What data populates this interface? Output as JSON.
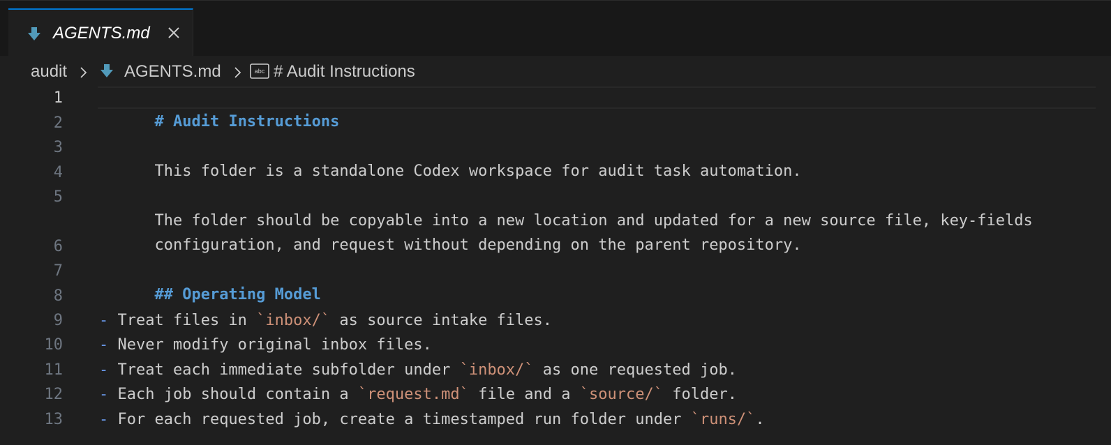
{
  "colors": {
    "accent": "#0078d4",
    "heading": "#569cd6",
    "inline_code": "#ce9178",
    "bullet": "#6796e6",
    "text": "#cccccc",
    "line_number": "#6e7681"
  },
  "tab": {
    "label": "AGENTS.md",
    "icon": "markdown-download-arrow-icon",
    "close_icon": "close-icon"
  },
  "breadcrumb": {
    "folder": "audit",
    "file": "AGENTS.md",
    "symbol": "# Audit Instructions",
    "symbol_icon": "abc-text-icon"
  },
  "editor": {
    "active_line": "1",
    "line_numbers": [
      "1",
      "2",
      "3",
      "4",
      "5",
      "",
      "6",
      "7",
      "8",
      "9",
      "10",
      "11",
      "12",
      "13"
    ],
    "lines": {
      "l1": "# Audit Instructions",
      "l3": "This folder is a standalone Codex workspace for audit task automation.",
      "l5a": "The folder should be copyable into a new location and updated for a new source file, key-fields",
      "l5b": "configuration, and request without depending on the parent repository.",
      "l7": "## Operating Model",
      "l9": {
        "b": "-",
        "t1": " Treat files in ",
        "c1": "`inbox/`",
        "t2": " as source intake files."
      },
      "l10": {
        "b": "-",
        "t1": " Never modify original inbox files."
      },
      "l11": {
        "b": "-",
        "t1": " Treat each immediate subfolder under ",
        "c1": "`inbox/`",
        "t2": " as one requested job."
      },
      "l12": {
        "b": "-",
        "t1": " Each job should contain a ",
        "c1": "`request.md`",
        "t2": " file and a ",
        "c2": "`source/`",
        "t3": " folder."
      },
      "l13": {
        "b": "-",
        "t1": " For each requested job, create a timestamped run folder under ",
        "c1": "`runs/`",
        "t2": "."
      }
    }
  }
}
